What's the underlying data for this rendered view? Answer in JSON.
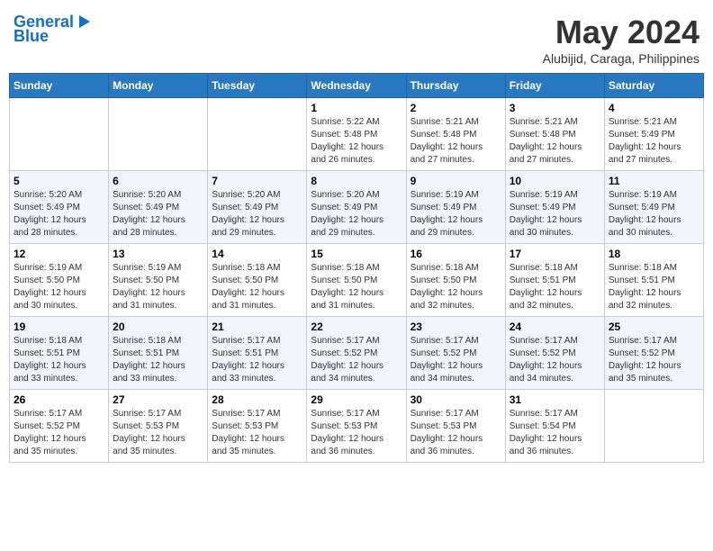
{
  "header": {
    "logo_line1": "General",
    "logo_line2": "Blue",
    "month": "May 2024",
    "location": "Alubijid, Caraga, Philippines"
  },
  "days_of_week": [
    "Sunday",
    "Monday",
    "Tuesday",
    "Wednesday",
    "Thursday",
    "Friday",
    "Saturday"
  ],
  "weeks": [
    [
      {
        "day": null,
        "info": null
      },
      {
        "day": null,
        "info": null
      },
      {
        "day": null,
        "info": null
      },
      {
        "day": "1",
        "info": "Sunrise: 5:22 AM\nSunset: 5:48 PM\nDaylight: 12 hours\nand 26 minutes."
      },
      {
        "day": "2",
        "info": "Sunrise: 5:21 AM\nSunset: 5:48 PM\nDaylight: 12 hours\nand 27 minutes."
      },
      {
        "day": "3",
        "info": "Sunrise: 5:21 AM\nSunset: 5:48 PM\nDaylight: 12 hours\nand 27 minutes."
      },
      {
        "day": "4",
        "info": "Sunrise: 5:21 AM\nSunset: 5:49 PM\nDaylight: 12 hours\nand 27 minutes."
      }
    ],
    [
      {
        "day": "5",
        "info": "Sunrise: 5:20 AM\nSunset: 5:49 PM\nDaylight: 12 hours\nand 28 minutes."
      },
      {
        "day": "6",
        "info": "Sunrise: 5:20 AM\nSunset: 5:49 PM\nDaylight: 12 hours\nand 28 minutes."
      },
      {
        "day": "7",
        "info": "Sunrise: 5:20 AM\nSunset: 5:49 PM\nDaylight: 12 hours\nand 29 minutes."
      },
      {
        "day": "8",
        "info": "Sunrise: 5:20 AM\nSunset: 5:49 PM\nDaylight: 12 hours\nand 29 minutes."
      },
      {
        "day": "9",
        "info": "Sunrise: 5:19 AM\nSunset: 5:49 PM\nDaylight: 12 hours\nand 29 minutes."
      },
      {
        "day": "10",
        "info": "Sunrise: 5:19 AM\nSunset: 5:49 PM\nDaylight: 12 hours\nand 30 minutes."
      },
      {
        "day": "11",
        "info": "Sunrise: 5:19 AM\nSunset: 5:49 PM\nDaylight: 12 hours\nand 30 minutes."
      }
    ],
    [
      {
        "day": "12",
        "info": "Sunrise: 5:19 AM\nSunset: 5:50 PM\nDaylight: 12 hours\nand 30 minutes."
      },
      {
        "day": "13",
        "info": "Sunrise: 5:19 AM\nSunset: 5:50 PM\nDaylight: 12 hours\nand 31 minutes."
      },
      {
        "day": "14",
        "info": "Sunrise: 5:18 AM\nSunset: 5:50 PM\nDaylight: 12 hours\nand 31 minutes."
      },
      {
        "day": "15",
        "info": "Sunrise: 5:18 AM\nSunset: 5:50 PM\nDaylight: 12 hours\nand 31 minutes."
      },
      {
        "day": "16",
        "info": "Sunrise: 5:18 AM\nSunset: 5:50 PM\nDaylight: 12 hours\nand 32 minutes."
      },
      {
        "day": "17",
        "info": "Sunrise: 5:18 AM\nSunset: 5:51 PM\nDaylight: 12 hours\nand 32 minutes."
      },
      {
        "day": "18",
        "info": "Sunrise: 5:18 AM\nSunset: 5:51 PM\nDaylight: 12 hours\nand 32 minutes."
      }
    ],
    [
      {
        "day": "19",
        "info": "Sunrise: 5:18 AM\nSunset: 5:51 PM\nDaylight: 12 hours\nand 33 minutes."
      },
      {
        "day": "20",
        "info": "Sunrise: 5:18 AM\nSunset: 5:51 PM\nDaylight: 12 hours\nand 33 minutes."
      },
      {
        "day": "21",
        "info": "Sunrise: 5:17 AM\nSunset: 5:51 PM\nDaylight: 12 hours\nand 33 minutes."
      },
      {
        "day": "22",
        "info": "Sunrise: 5:17 AM\nSunset: 5:52 PM\nDaylight: 12 hours\nand 34 minutes."
      },
      {
        "day": "23",
        "info": "Sunrise: 5:17 AM\nSunset: 5:52 PM\nDaylight: 12 hours\nand 34 minutes."
      },
      {
        "day": "24",
        "info": "Sunrise: 5:17 AM\nSunset: 5:52 PM\nDaylight: 12 hours\nand 34 minutes."
      },
      {
        "day": "25",
        "info": "Sunrise: 5:17 AM\nSunset: 5:52 PM\nDaylight: 12 hours\nand 35 minutes."
      }
    ],
    [
      {
        "day": "26",
        "info": "Sunrise: 5:17 AM\nSunset: 5:52 PM\nDaylight: 12 hours\nand 35 minutes."
      },
      {
        "day": "27",
        "info": "Sunrise: 5:17 AM\nSunset: 5:53 PM\nDaylight: 12 hours\nand 35 minutes."
      },
      {
        "day": "28",
        "info": "Sunrise: 5:17 AM\nSunset: 5:53 PM\nDaylight: 12 hours\nand 35 minutes."
      },
      {
        "day": "29",
        "info": "Sunrise: 5:17 AM\nSunset: 5:53 PM\nDaylight: 12 hours\nand 36 minutes."
      },
      {
        "day": "30",
        "info": "Sunrise: 5:17 AM\nSunset: 5:53 PM\nDaylight: 12 hours\nand 36 minutes."
      },
      {
        "day": "31",
        "info": "Sunrise: 5:17 AM\nSunset: 5:54 PM\nDaylight: 12 hours\nand 36 minutes."
      },
      {
        "day": null,
        "info": null
      }
    ]
  ]
}
